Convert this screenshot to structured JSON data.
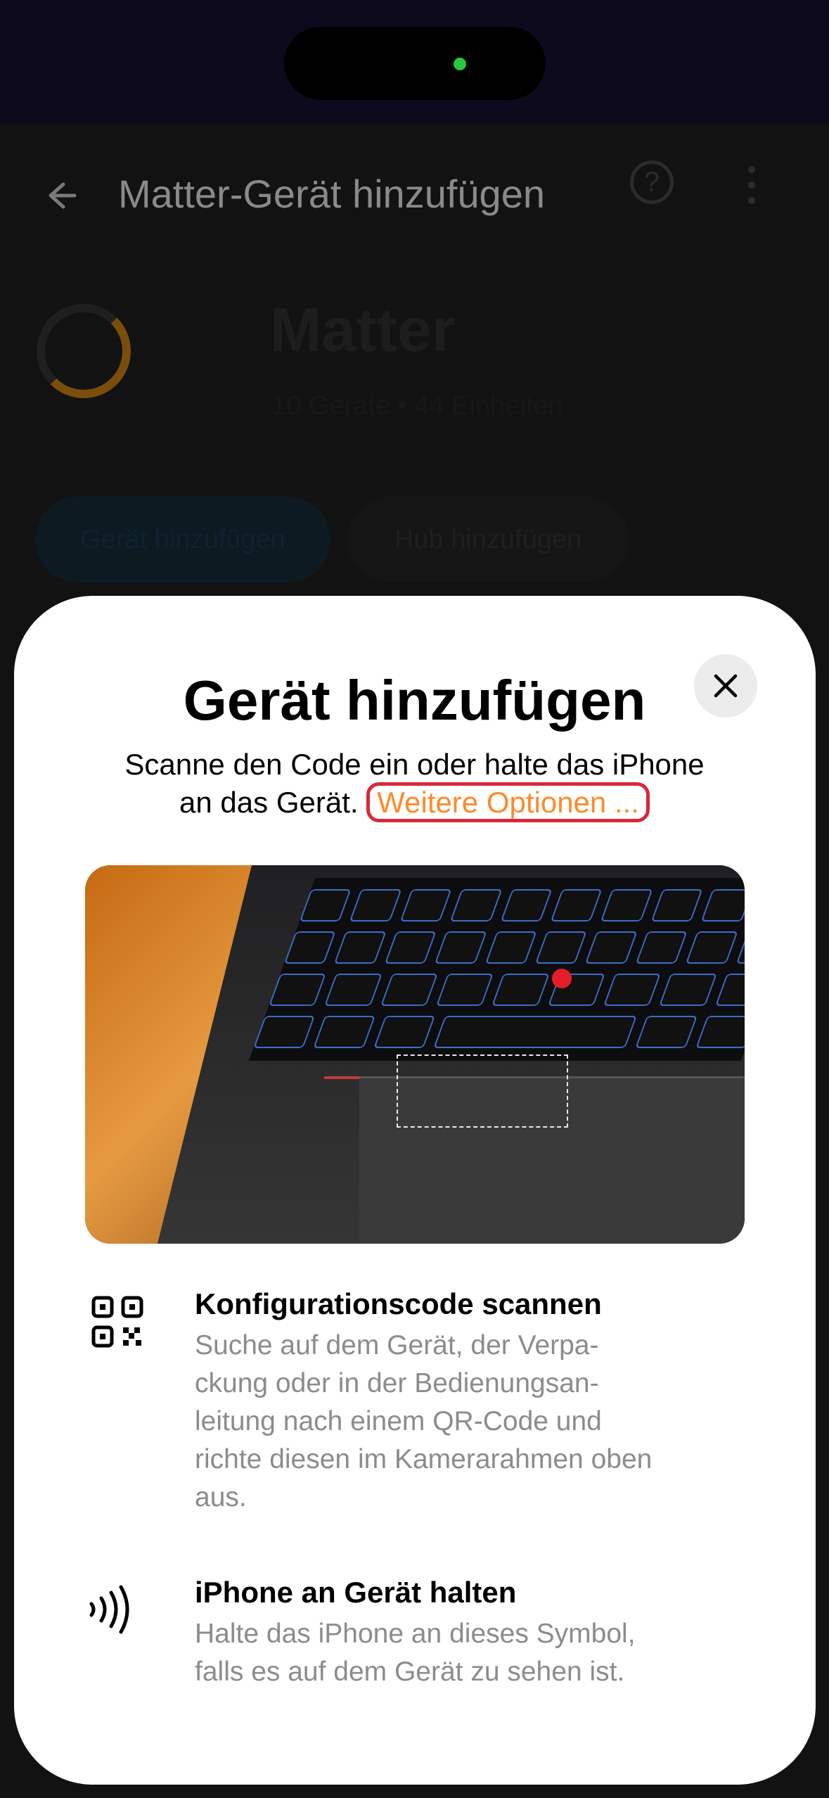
{
  "background": {
    "app_bar_title": "Matter-Gerät hinzufügen",
    "brand_title": "Matter",
    "brand_subtitle": "10 Geräte • 44 Einheiten",
    "buttons": [
      "Gerät hinzufügen",
      "Hub hinzufügen"
    ]
  },
  "sheet": {
    "title": "Gerät hinzufügen",
    "subtitle_line1": "Scanne den Code ein oder halte das iPhone",
    "subtitle_line2": "an das Gerät.",
    "more_options": "Weitere Optionen ..."
  },
  "rows": [
    {
      "title": "Konfigurationscode scannen",
      "desc_lines": [
        "Suche auf dem Gerät, der Verpa-",
        "ckung oder in der Bedienungsan-",
        "leitung nach einem QR-Code und",
        "richte diesen im Kamerarahmen oben",
        "aus."
      ]
    },
    {
      "title": "iPhone an Gerät halten",
      "desc_lines": [
        "Halte das iPhone an dieses Symbol,",
        "falls es auf dem Gerät zu sehen ist."
      ]
    }
  ],
  "colors": {
    "accent_link": "#ff8a2a",
    "highlight_outline": "#d8283a",
    "status_dot": "#28c840"
  },
  "icons": {
    "back": "arrow-left-icon",
    "help": "help-circle-icon",
    "menu": "kebab-menu-icon",
    "close": "close-icon",
    "qr": "qr-code-icon",
    "nfc": "nfc-icon"
  }
}
